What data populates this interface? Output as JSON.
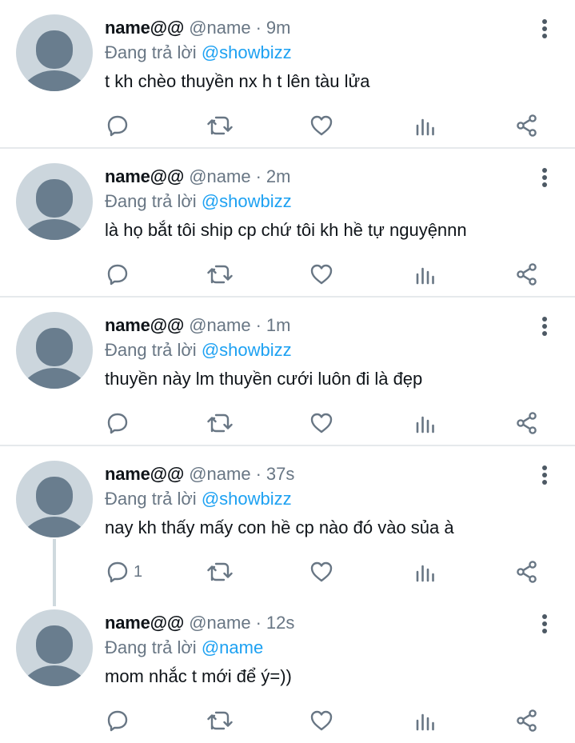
{
  "tweets": [
    {
      "display_name": "name@@",
      "handle": "@name",
      "separator": "·",
      "time": "9m",
      "reply_prefix": "Đang trả lời ",
      "reply_to": "@showbizz",
      "text": "t kh chèo thuyền nx h t lên tàu lửa",
      "reply_count": ""
    },
    {
      "display_name": "name@@",
      "handle": "@name",
      "separator": "·",
      "time": "2m",
      "reply_prefix": "Đang trả lời ",
      "reply_to": "@showbizz",
      "text": "là họ bắt tôi ship cp chứ tôi kh hề tự nguyệnnn",
      "reply_count": ""
    },
    {
      "display_name": "name@@",
      "handle": "@name",
      "separator": "·",
      "time": "1m",
      "reply_prefix": "Đang trả lời ",
      "reply_to": "@showbizz",
      "text": "thuyền này lm thuyền cưới luôn đi là đẹp",
      "reply_count": ""
    },
    {
      "display_name": "name@@",
      "handle": "@name",
      "separator": "·",
      "time": "37s",
      "reply_prefix": "Đang trả lời ",
      "reply_to": "@showbizz",
      "text": "nay kh thấy mấy con hề cp nào đó vào sủa à",
      "reply_count": "1"
    },
    {
      "display_name": "name@@",
      "handle": "@name",
      "separator": "·",
      "time": "12s",
      "reply_prefix": "Đang trả lời ",
      "reply_to": "@name",
      "text": "mom nhắc t mới để ý=))",
      "reply_count": ""
    }
  ],
  "icons": {
    "more": "more-vertical-icon",
    "reply": "reply-icon",
    "retweet": "retweet-icon",
    "like": "heart-icon",
    "analytics": "analytics-icon",
    "share": "share-icon"
  },
  "colors": {
    "text": "#0f1419",
    "secondary": "#687684",
    "mention": "#1da1f2",
    "avatar_bg": "#ccd6dd",
    "avatar_fg": "#697d8e",
    "divider": "#e6e9ec",
    "thread_line": "#cfd9de"
  }
}
